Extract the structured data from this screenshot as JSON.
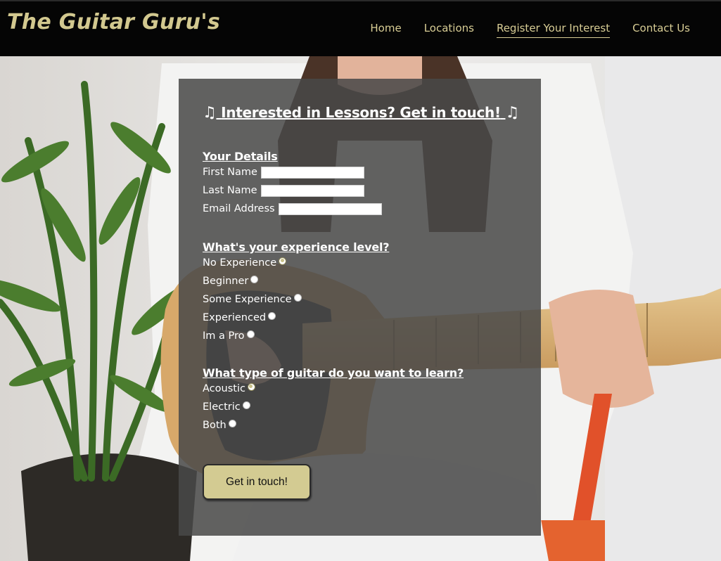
{
  "header": {
    "brand": "The Guitar Guru's",
    "nav": [
      {
        "label": "Home",
        "active": false
      },
      {
        "label": "Locations",
        "active": false
      },
      {
        "label": "Register Your Interest",
        "active": true
      },
      {
        "label": "Contact Us",
        "active": false
      }
    ]
  },
  "form": {
    "title": "Interested in Lessons? Get in touch!",
    "note_glyph": "♫",
    "details": {
      "heading": "Your Details",
      "first_name_label": "First Name",
      "last_name_label": "Last Name",
      "email_label": "Email Address",
      "first_name_value": "",
      "last_name_value": "",
      "email_value": ""
    },
    "experience": {
      "heading": "What's your experience level?",
      "options": [
        "No Experience",
        "Beginner",
        "Some Experience",
        "Experienced",
        "Im a Pro"
      ],
      "selected": "No Experience"
    },
    "guitar_type": {
      "heading": "What type of guitar do you want to learn?",
      "options": [
        "Acoustic",
        "Electric",
        "Both"
      ],
      "selected": "Acoustic"
    },
    "submit_label": "Get in touch!"
  },
  "colors": {
    "header_bg": "#050505",
    "accent": "#d3cb92",
    "panel_bg": "rgba(72,72,72,0.86)"
  }
}
